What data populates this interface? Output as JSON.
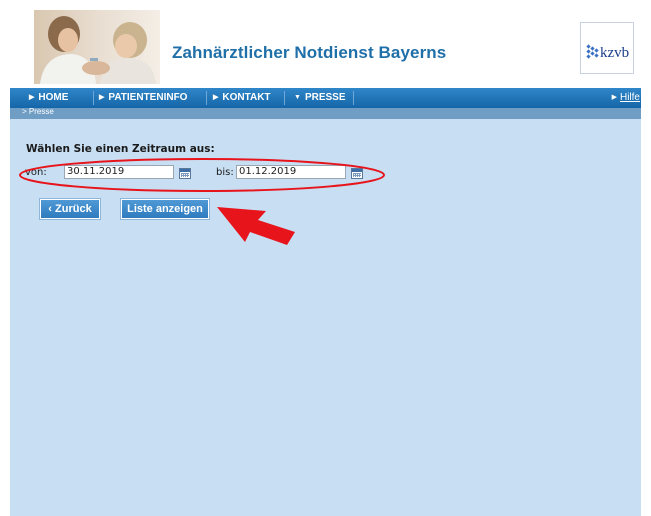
{
  "header": {
    "title": "Zahnärztlicher Notdienst Bayerns",
    "logo_text": "kzvb"
  },
  "nav": {
    "items": [
      {
        "label": "HOME",
        "icon": "arrow-right-icon"
      },
      {
        "label": "PATIENTENINFO",
        "icon": "arrow-right-icon"
      },
      {
        "label": "KONTAKT",
        "icon": "arrow-right-icon"
      },
      {
        "label": "PRESSE",
        "icon": "chevron-down-icon"
      }
    ],
    "help": "Hilfe"
  },
  "breadcrumb": ">  Presse",
  "form": {
    "heading": "Wählen Sie einen Zeitraum aus:",
    "from_label": "von:",
    "from_value": "30.11.2019",
    "to_label": "bis:",
    "to_value": "01.12.2019"
  },
  "buttons": {
    "back": "‹ Zurück",
    "show_list": "Liste anzeigen"
  },
  "colors": {
    "brand_blue": "#1f6fa8",
    "nav_blue": "#1f76b8",
    "content_bg": "#c8dff3",
    "annotation_red": "#e8141c"
  }
}
